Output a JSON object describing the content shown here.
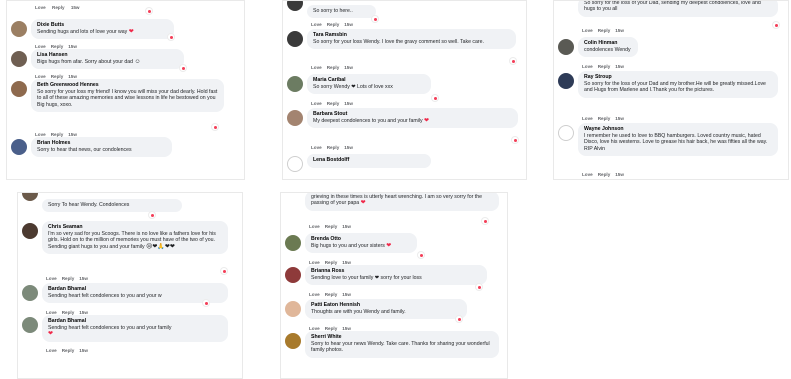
{
  "comment_actions": {
    "like": "Love",
    "reply": "Reply",
    "time": "15w"
  },
  "colors": {
    "bubble": "#f0f2f5",
    "meta": "#65676b",
    "heart": "#f02849"
  },
  "panels": [
    {
      "stub_text": "",
      "comments": [
        {
          "name": "Dixie Butts",
          "text": "Sending hugs and lots of love your way",
          "emoji": "❤",
          "avatar": "#9b7f63"
        },
        {
          "name": "Lisa Hansen",
          "text": "Bigs hugs from afar. Sorry about your dad",
          "emoji": "☺",
          "avatar": "#6f5f52"
        },
        {
          "name": "Beth Greenwood Hennes",
          "text": "So sorry for your loss my friend! I know you will miss your dad dearly. Hold fast to all of these amazing memories and wise lessons in life he bestowed on you Big hugs, xoxo.",
          "emoji": "",
          "avatar": "#8e6a4e"
        },
        {
          "name": "Brian Holmes",
          "text": "Sorry to hear that news, our condolences",
          "emoji": "",
          "avatar": "#4a5f8a"
        }
      ]
    },
    {
      "stub_text": "So sorry to here..",
      "comments": [
        {
          "name": "Tara Ramsbin",
          "text": "So sorry for your loss Wendy. I love the gravy comment so well. Take care.",
          "emoji": "",
          "avatar": "#3a3a3a"
        },
        {
          "name": "Maria Caribal",
          "text": "So sorry Wendy ❤ Lots of love xxx",
          "emoji": "",
          "avatar": "#6c7c62"
        },
        {
          "name": "Barbara Stout",
          "text": "My deepest condolences to you and your family",
          "emoji": "❤",
          "avatar": "#a38470"
        },
        {
          "name": "Lena Bostdolff",
          "text": "",
          "emoji": "",
          "avatar": "#d9d9d9"
        }
      ]
    },
    {
      "stub_text": "So sorry for the loss of your Dad, sending my deepest condolences, love and hugs to you all",
      "comments": [
        {
          "name": "Colin Hinman",
          "text": "condolences Wendy",
          "emoji": "",
          "avatar": "#5a5a54"
        },
        {
          "name": "Ray Stroup",
          "text": "So sorry for the loss of your Dad and my brother.He will be greatly missed.Love and Hugs from Marlene and I.Thank you for the pictures.",
          "emoji": "",
          "avatar": "#2e3b57"
        },
        {
          "name": "Wayne Johnson",
          "text": "I remember he used to love to BBQ hamburgers. Loved country music, hated Disco, love his westerns. Love to grease his hair back, he was fifties all the way. RIP Alvin",
          "emoji": "",
          "avatar": "#cfcfcf"
        }
      ]
    },
    {
      "stub_text": "Sorry To hear Wendy. Condolences",
      "comments": [
        {
          "name": "Chris Seaman",
          "text": "I'm so very sad for you Scoogs. There is no love like a fathers love for his girls. Hold on to the million of memories you must have of the two of you. Sending giant hugs to you and your family",
          "emoji": "😢❤🙏❤❤",
          "avatar": "#4c3a30"
        },
        {
          "name": "Bardan Bhamal",
          "text": "Sending heart felt condolences to you and your w",
          "emoji": "",
          "avatar": "#7c8a7a"
        },
        {
          "name": "Bardan Bhamal",
          "text": "Sending heart felt condolences to you and your family",
          "emoji": "❤",
          "avatar": "#7c8a7a"
        }
      ]
    },
    {
      "stub_text": "grieving in these times is utterly heart wrenching. I am so very sorry for the passing of your papa",
      "comments": [
        {
          "name": "Brenda Otto",
          "text": "Big hugs to you and your sisters",
          "emoji": "❤",
          "avatar": "#6b7a52"
        },
        {
          "name": "Brianna Ross",
          "text": "Sending love to your family ❤ sorry for your loss",
          "emoji": "",
          "avatar": "#8e3a3a"
        },
        {
          "name": "Patti Eaton Hennish",
          "text": "Thoughts are with you Wendy and family.",
          "emoji": "",
          "avatar": "#e0b79a"
        },
        {
          "name": "Sherri White",
          "text": "Sorry to hear your news Wendy. Take care. Thanks for sharing your wonderful family photos.",
          "emoji": "",
          "avatar": "#a87a2c"
        }
      ]
    }
  ]
}
